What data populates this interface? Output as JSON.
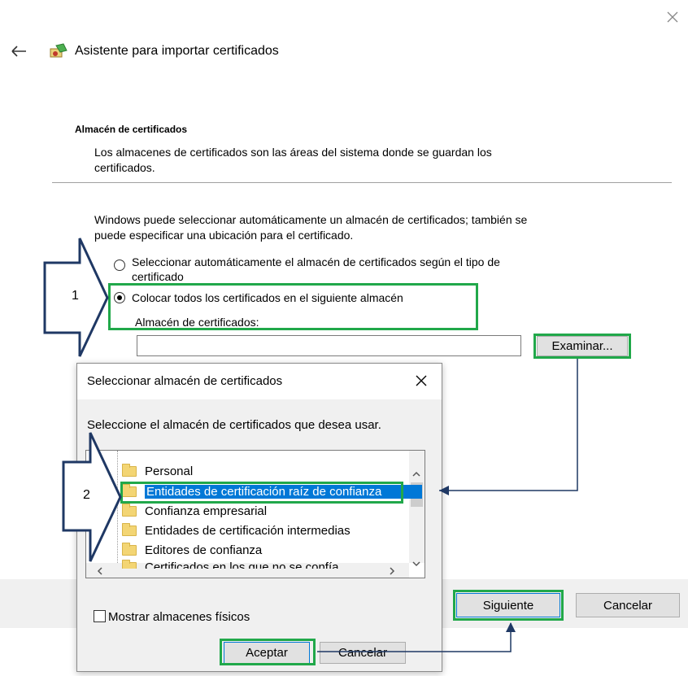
{
  "wizard": {
    "title": "Asistente para importar certificados",
    "section_title": "Almacén de certificados",
    "section_desc_1": "Los almacenes de certificados son las áreas del sistema donde se guardan los",
    "section_desc_2": "certificados.",
    "intro_1": "Windows puede seleccionar automáticamente un almacén de certificados; también se",
    "intro_2": "puede especificar una ubicación para el certificado.",
    "radio_auto_1": "Seleccionar automáticamente el almacén de certificados según el tipo de",
    "radio_auto_2": "certificado",
    "radio_manual": "Colocar todos los certificados en el siguiente almacén",
    "store_label": "Almacén de certificados:",
    "store_value": "",
    "browse_button": "Examinar...",
    "next_button": "Siguiente",
    "cancel_button": "Cancelar"
  },
  "dialog": {
    "title": "Seleccionar almacén de certificados",
    "instruction": "Seleccione el almacén de certificados que desea usar.",
    "stores": [
      "Personal",
      "Entidades de certificación raíz de confianza",
      "Confianza empresarial",
      "Entidades de certificación intermedias",
      "Editores de confianza",
      "Certificados en los que no se confía"
    ],
    "show_physical": "Mostrar almacenes físicos",
    "ok_button": "Aceptar",
    "cancel_button": "Cancelar"
  },
  "annotations": {
    "step1": "1",
    "step2": "2",
    "highlight_color": "#21a84a",
    "arrow_color": "#1f3864"
  },
  "icons": [
    "close-icon",
    "back-arrow-icon",
    "certificate-icon",
    "folder-icon",
    "scroll-up-icon",
    "scroll-down-icon",
    "scroll-left-icon",
    "scroll-right-icon"
  ]
}
